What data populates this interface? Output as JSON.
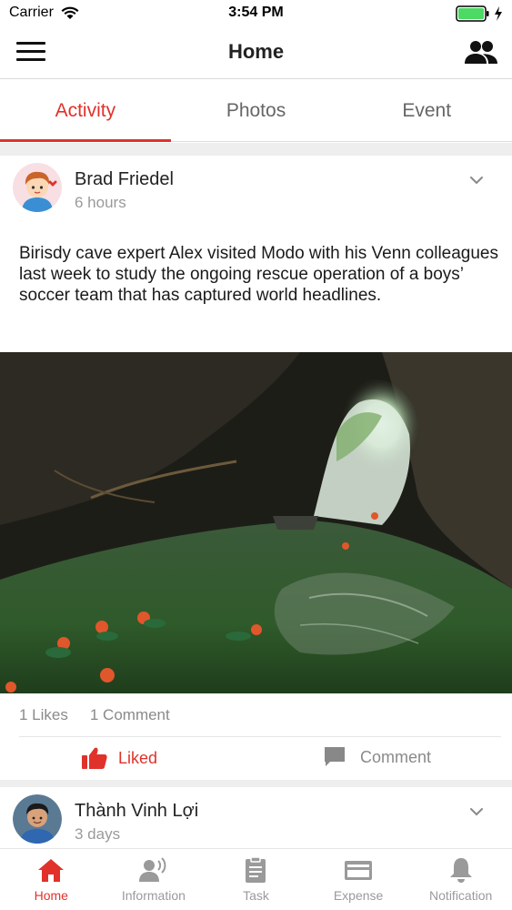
{
  "status_bar": {
    "carrier": "Carrier",
    "time": "3:54 PM"
  },
  "nav": {
    "title": "Home"
  },
  "tabs": [
    {
      "label": "Activity",
      "active": true
    },
    {
      "label": "Photos",
      "active": false
    },
    {
      "label": "Event",
      "active": false
    }
  ],
  "posts": [
    {
      "author": "Brad Friedel",
      "time": "6 hours",
      "text": "Birisdy cave expert Alex visited Modo with his Venn colleagues last week to study the ongoing rescue operation of a boys’ soccer team that has captured world headlines.",
      "likes": "1 Likes",
      "comments": "1 Comment",
      "like_label": "Liked",
      "comment_label": "Comment"
    },
    {
      "author": "Thành Vinh Lợi",
      "time": "3 days"
    }
  ],
  "bottom_tabs": [
    {
      "label": "Home",
      "icon": "home-icon",
      "active": true
    },
    {
      "label": "Information",
      "icon": "speaker-person-icon",
      "active": false
    },
    {
      "label": "Task",
      "icon": "clipboard-icon",
      "active": false
    },
    {
      "label": "Expense",
      "icon": "credit-card-icon",
      "active": false
    },
    {
      "label": "Notification",
      "icon": "bell-icon",
      "active": false
    }
  ],
  "colors": {
    "accent": "#e0322b",
    "inactive": "#9a9a9a",
    "battery": "#4cd964"
  }
}
